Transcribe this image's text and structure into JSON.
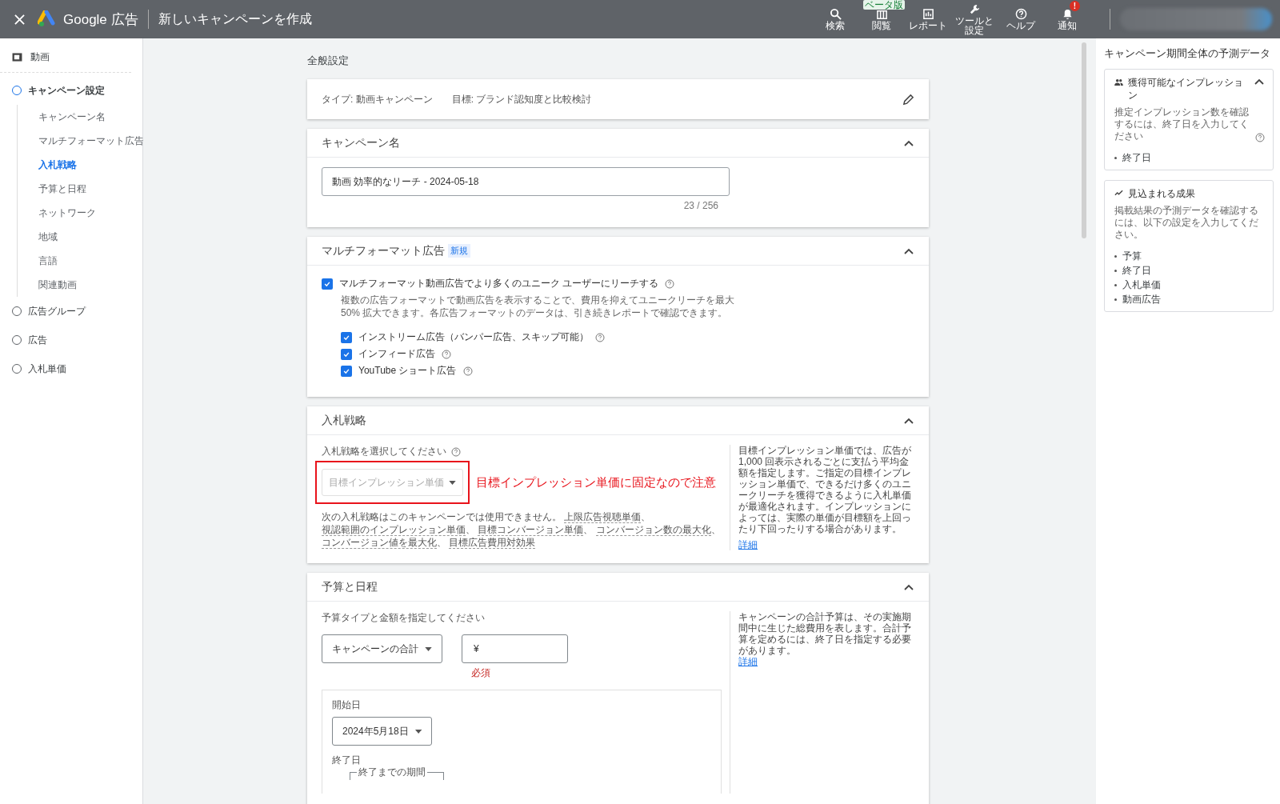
{
  "header": {
    "title": "新しいキャンペーンを作成",
    "product": "Google 広告",
    "tools": [
      {
        "kind": "search",
        "label": "検索"
      },
      {
        "kind": "view",
        "label": "閲覧",
        "badge": "ベータ版"
      },
      {
        "kind": "report",
        "label": "レポート"
      },
      {
        "kind": "tools",
        "label": "ツールと設定"
      },
      {
        "kind": "help",
        "label": "ヘルプ"
      },
      {
        "kind": "bell",
        "label": "通知",
        "badge": "!"
      }
    ]
  },
  "sidebar": {
    "top": "動画",
    "steps": [
      {
        "label": "キャンペーン設定",
        "selected": true,
        "children": [
          {
            "label": "キャンペーン名",
            "selected": false
          },
          {
            "label": "マルチフォーマット広告",
            "selected": false
          },
          {
            "label": "入札戦略",
            "selected": true
          },
          {
            "label": "予算と日程",
            "selected": false
          },
          {
            "label": "ネットワーク",
            "selected": false
          },
          {
            "label": "地域",
            "selected": false
          },
          {
            "label": "言語",
            "selected": false
          },
          {
            "label": "関連動画",
            "selected": false
          }
        ]
      },
      {
        "label": "広告グループ",
        "selected": false
      },
      {
        "label": "広告",
        "selected": false
      },
      {
        "label": "入札単価",
        "selected": false
      }
    ]
  },
  "main": {
    "heading": "全般設定",
    "summary": {
      "type": "タイプ: 動画キャンペーン",
      "goal": "目標: ブランド認知度と比較検討"
    },
    "campaign_name": {
      "title": "キャンペーン名",
      "expanded": true,
      "value": "動画 効率的なリーチ - 2024-05-18",
      "counter": "23 / 256"
    },
    "multiformat": {
      "title": "マルチフォーマット広告",
      "badge": "新規",
      "expanded": true,
      "main_option": {
        "label": "マルチフォーマット動画広告でより多くのユニーク ユーザーにリーチする",
        "checked": true
      },
      "description": "複数の広告フォーマットで動画広告を表示することで、費用を抑えてユニークリーチを最大 50% 拡大できます。各広告フォーマットのデータは、引き続きレポートで確認できます。",
      "options": [
        {
          "label": "インストリーム広告（バンパー広告、スキップ可能）",
          "checked": true
        },
        {
          "label": "インフィード広告",
          "checked": true
        },
        {
          "label": "YouTube ショート広告",
          "checked": true
        }
      ]
    },
    "bidding": {
      "title": "入札戦略",
      "expanded": true,
      "prompt": "入札戦略を選択してください",
      "select": "目標インプレッション単価",
      "disabled": true,
      "annotation": "目標インプレッション単価に固定なので注意",
      "unavailable_intro": "次の入札戦略はこのキャンペーンでは使用できません。",
      "unavailable": [
        "上限広告視聴単価",
        "視認範囲のインプレッション単価",
        "目標コンバージョン単価",
        "コンバージョン数の最大化",
        "コンバージョン値を最大化",
        "目標広告費用対効果"
      ],
      "separator": "、",
      "help": "目標インプレッション単価では、広告が 1,000 回表示されるごとに支払う平均金額を指定します。ご指定の目標インプレッション単価で、できるだけ多くのユニークリーチを獲得できるように入札単価が最適化されます。インプレッションによっては、実際の単価が目標額を上回ったり下回ったりする場合があります。",
      "link": "詳細"
    },
    "budget": {
      "title": "予算と日程",
      "expanded": true,
      "prompt": "予算タイプと金額を指定してください",
      "type_select": "キャンペーンの合計",
      "currency": "¥",
      "required": "必須",
      "help": "キャンペーンの合計予算は、その実施期間中に生じた総費用を表します。合計予算を定めるには、終了日を指定する必要があります。",
      "link": "詳細",
      "start_label": "開始日",
      "start_value": "2024年5月18日",
      "end_label": "終了日",
      "end_field_label": "終了までの期間"
    }
  },
  "forecast": {
    "title": "キャンペーン期間全体の予測データ",
    "cards": [
      {
        "kind": "people",
        "title": "獲得可能なインプレッション",
        "collapsible": true,
        "text": "推定インプレッション数を確認するには、終了日を入力してください",
        "help": true,
        "items": [
          "終了日"
        ]
      },
      {
        "kind": "trend",
        "title": "見込まれる成果",
        "collapsible": false,
        "text": "掲載結果の予測データを確認するには、以下の設定を入力してください。",
        "help": false,
        "items": [
          "予算",
          "終了日",
          "入札単価",
          "動画広告"
        ]
      }
    ]
  }
}
